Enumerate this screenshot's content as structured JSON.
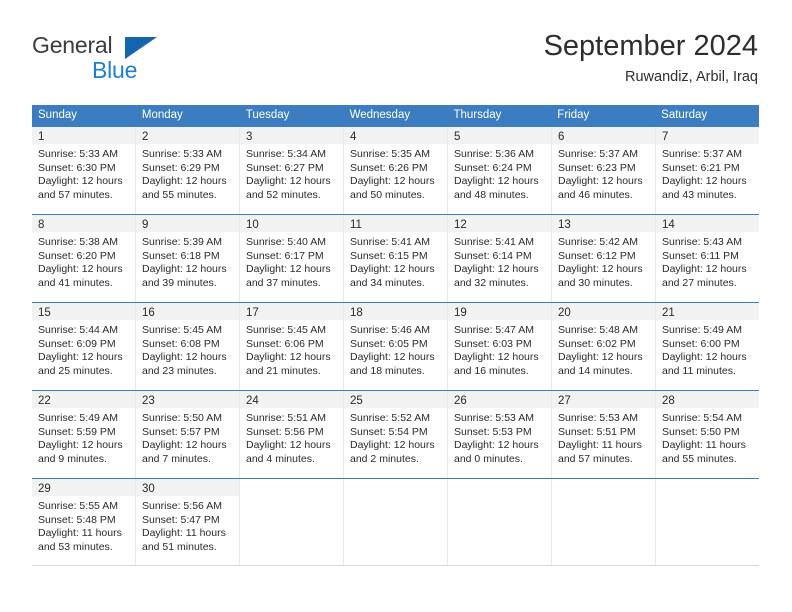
{
  "brand": {
    "name_top": "General",
    "name_bottom": "Blue",
    "triangle_color": "#1565ae",
    "blue_text_color": "#1f7fd4"
  },
  "header": {
    "title": "September 2024",
    "location": "Ruwandiz, Arbil, Iraq"
  },
  "theme": {
    "header_blue": "#3b7dc0",
    "daynum_band": "#f2f2f2",
    "text": "#2b2b2b"
  },
  "weekdays": [
    "Sunday",
    "Monday",
    "Tuesday",
    "Wednesday",
    "Thursday",
    "Friday",
    "Saturday"
  ],
  "weeks": [
    [
      {
        "day": "1",
        "sunrise": "Sunrise: 5:33 AM",
        "sunset": "Sunset: 6:30 PM",
        "daylight1": "Daylight: 12 hours",
        "daylight2": "and 57 minutes."
      },
      {
        "day": "2",
        "sunrise": "Sunrise: 5:33 AM",
        "sunset": "Sunset: 6:29 PM",
        "daylight1": "Daylight: 12 hours",
        "daylight2": "and 55 minutes."
      },
      {
        "day": "3",
        "sunrise": "Sunrise: 5:34 AM",
        "sunset": "Sunset: 6:27 PM",
        "daylight1": "Daylight: 12 hours",
        "daylight2": "and 52 minutes."
      },
      {
        "day": "4",
        "sunrise": "Sunrise: 5:35 AM",
        "sunset": "Sunset: 6:26 PM",
        "daylight1": "Daylight: 12 hours",
        "daylight2": "and 50 minutes."
      },
      {
        "day": "5",
        "sunrise": "Sunrise: 5:36 AM",
        "sunset": "Sunset: 6:24 PM",
        "daylight1": "Daylight: 12 hours",
        "daylight2": "and 48 minutes."
      },
      {
        "day": "6",
        "sunrise": "Sunrise: 5:37 AM",
        "sunset": "Sunset: 6:23 PM",
        "daylight1": "Daylight: 12 hours",
        "daylight2": "and 46 minutes."
      },
      {
        "day": "7",
        "sunrise": "Sunrise: 5:37 AM",
        "sunset": "Sunset: 6:21 PM",
        "daylight1": "Daylight: 12 hours",
        "daylight2": "and 43 minutes."
      }
    ],
    [
      {
        "day": "8",
        "sunrise": "Sunrise: 5:38 AM",
        "sunset": "Sunset: 6:20 PM",
        "daylight1": "Daylight: 12 hours",
        "daylight2": "and 41 minutes."
      },
      {
        "day": "9",
        "sunrise": "Sunrise: 5:39 AM",
        "sunset": "Sunset: 6:18 PM",
        "daylight1": "Daylight: 12 hours",
        "daylight2": "and 39 minutes."
      },
      {
        "day": "10",
        "sunrise": "Sunrise: 5:40 AM",
        "sunset": "Sunset: 6:17 PM",
        "daylight1": "Daylight: 12 hours",
        "daylight2": "and 37 minutes."
      },
      {
        "day": "11",
        "sunrise": "Sunrise: 5:41 AM",
        "sunset": "Sunset: 6:15 PM",
        "daylight1": "Daylight: 12 hours",
        "daylight2": "and 34 minutes."
      },
      {
        "day": "12",
        "sunrise": "Sunrise: 5:41 AM",
        "sunset": "Sunset: 6:14 PM",
        "daylight1": "Daylight: 12 hours",
        "daylight2": "and 32 minutes."
      },
      {
        "day": "13",
        "sunrise": "Sunrise: 5:42 AM",
        "sunset": "Sunset: 6:12 PM",
        "daylight1": "Daylight: 12 hours",
        "daylight2": "and 30 minutes."
      },
      {
        "day": "14",
        "sunrise": "Sunrise: 5:43 AM",
        "sunset": "Sunset: 6:11 PM",
        "daylight1": "Daylight: 12 hours",
        "daylight2": "and 27 minutes."
      }
    ],
    [
      {
        "day": "15",
        "sunrise": "Sunrise: 5:44 AM",
        "sunset": "Sunset: 6:09 PM",
        "daylight1": "Daylight: 12 hours",
        "daylight2": "and 25 minutes."
      },
      {
        "day": "16",
        "sunrise": "Sunrise: 5:45 AM",
        "sunset": "Sunset: 6:08 PM",
        "daylight1": "Daylight: 12 hours",
        "daylight2": "and 23 minutes."
      },
      {
        "day": "17",
        "sunrise": "Sunrise: 5:45 AM",
        "sunset": "Sunset: 6:06 PM",
        "daylight1": "Daylight: 12 hours",
        "daylight2": "and 21 minutes."
      },
      {
        "day": "18",
        "sunrise": "Sunrise: 5:46 AM",
        "sunset": "Sunset: 6:05 PM",
        "daylight1": "Daylight: 12 hours",
        "daylight2": "and 18 minutes."
      },
      {
        "day": "19",
        "sunrise": "Sunrise: 5:47 AM",
        "sunset": "Sunset: 6:03 PM",
        "daylight1": "Daylight: 12 hours",
        "daylight2": "and 16 minutes."
      },
      {
        "day": "20",
        "sunrise": "Sunrise: 5:48 AM",
        "sunset": "Sunset: 6:02 PM",
        "daylight1": "Daylight: 12 hours",
        "daylight2": "and 14 minutes."
      },
      {
        "day": "21",
        "sunrise": "Sunrise: 5:49 AM",
        "sunset": "Sunset: 6:00 PM",
        "daylight1": "Daylight: 12 hours",
        "daylight2": "and 11 minutes."
      }
    ],
    [
      {
        "day": "22",
        "sunrise": "Sunrise: 5:49 AM",
        "sunset": "Sunset: 5:59 PM",
        "daylight1": "Daylight: 12 hours",
        "daylight2": "and 9 minutes."
      },
      {
        "day": "23",
        "sunrise": "Sunrise: 5:50 AM",
        "sunset": "Sunset: 5:57 PM",
        "daylight1": "Daylight: 12 hours",
        "daylight2": "and 7 minutes."
      },
      {
        "day": "24",
        "sunrise": "Sunrise: 5:51 AM",
        "sunset": "Sunset: 5:56 PM",
        "daylight1": "Daylight: 12 hours",
        "daylight2": "and 4 minutes."
      },
      {
        "day": "25",
        "sunrise": "Sunrise: 5:52 AM",
        "sunset": "Sunset: 5:54 PM",
        "daylight1": "Daylight: 12 hours",
        "daylight2": "and 2 minutes."
      },
      {
        "day": "26",
        "sunrise": "Sunrise: 5:53 AM",
        "sunset": "Sunset: 5:53 PM",
        "daylight1": "Daylight: 12 hours",
        "daylight2": "and 0 minutes."
      },
      {
        "day": "27",
        "sunrise": "Sunrise: 5:53 AM",
        "sunset": "Sunset: 5:51 PM",
        "daylight1": "Daylight: 11 hours",
        "daylight2": "and 57 minutes."
      },
      {
        "day": "28",
        "sunrise": "Sunrise: 5:54 AM",
        "sunset": "Sunset: 5:50 PM",
        "daylight1": "Daylight: 11 hours",
        "daylight2": "and 55 minutes."
      }
    ],
    [
      {
        "day": "29",
        "sunrise": "Sunrise: 5:55 AM",
        "sunset": "Sunset: 5:48 PM",
        "daylight1": "Daylight: 11 hours",
        "daylight2": "and 53 minutes."
      },
      {
        "day": "30",
        "sunrise": "Sunrise: 5:56 AM",
        "sunset": "Sunset: 5:47 PM",
        "daylight1": "Daylight: 11 hours",
        "daylight2": "and 51 minutes."
      },
      {
        "day": "",
        "sunrise": "",
        "sunset": "",
        "daylight1": "",
        "daylight2": ""
      },
      {
        "day": "",
        "sunrise": "",
        "sunset": "",
        "daylight1": "",
        "daylight2": ""
      },
      {
        "day": "",
        "sunrise": "",
        "sunset": "",
        "daylight1": "",
        "daylight2": ""
      },
      {
        "day": "",
        "sunrise": "",
        "sunset": "",
        "daylight1": "",
        "daylight2": ""
      },
      {
        "day": "",
        "sunrise": "",
        "sunset": "",
        "daylight1": "",
        "daylight2": ""
      }
    ]
  ]
}
